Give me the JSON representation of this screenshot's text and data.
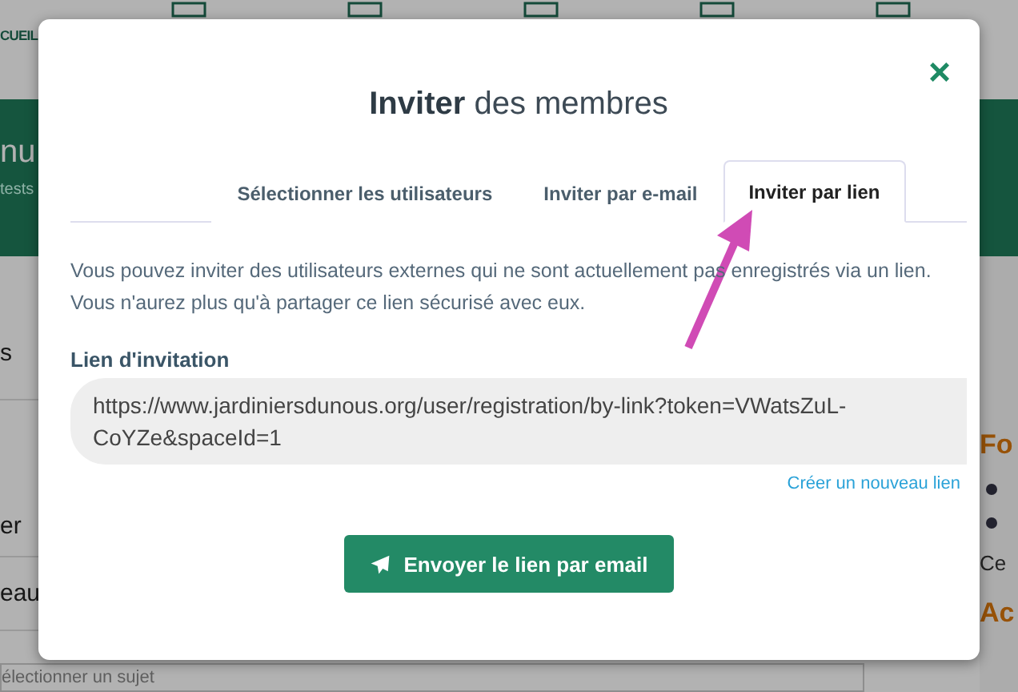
{
  "background": {
    "nav_label": "CUEIL",
    "hero_title": "nu",
    "hero_subtitle": "tests",
    "left_items": [
      "s",
      "er",
      "eau"
    ],
    "right_heading": "Fo",
    "right_text": "Ce",
    "right_heading_2": "Ac",
    "topic_placeholder": "électionner un sujet"
  },
  "modal": {
    "title": "**Inviter** des membres",
    "close": "×",
    "tabs": [
      {
        "label": "Sélectionner les utilisateurs",
        "selected": false
      },
      {
        "label": "Inviter par e-mail",
        "selected": false
      },
      {
        "label": "Inviter par lien",
        "selected": true
      }
    ],
    "description": "Vous pouvez inviter des utilisateurs externes qui ne sont actuellement pas enregistrés via un lien. Vous n'aurez plus qu'à partager ce lien sécurisé avec eux.",
    "field_label": "Lien d'invitation",
    "link_value": "https://www.jardiniersdunous.org/user/registration/by-link?token=VWatsZuL-CoYZe&spaceId=1",
    "new_link": "Créer un nouveau lien",
    "send_button": "Envoyer le lien par email"
  }
}
